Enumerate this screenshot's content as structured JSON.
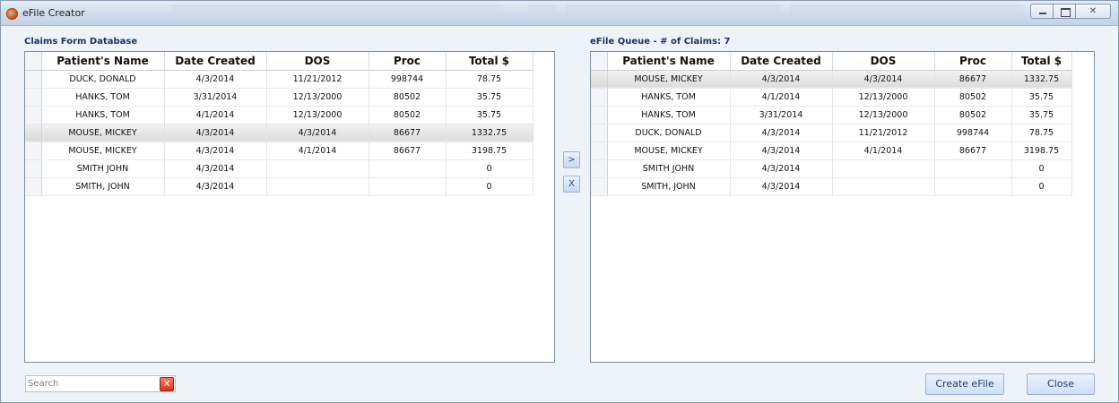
{
  "window": {
    "title": "eFile Creator"
  },
  "left_panel": {
    "title": "Claims Form Database",
    "columns": [
      "Patient's Name",
      "Date Created",
      "DOS",
      "Proc",
      "Total $"
    ],
    "rows": [
      {
        "name": "DUCK, DONALD",
        "date_created": "4/3/2014",
        "dos": "11/21/2012",
        "proc": "998744",
        "total": "78.75",
        "selected": false
      },
      {
        "name": "HANKS, TOM",
        "date_created": "3/31/2014",
        "dos": "12/13/2000",
        "proc": "80502",
        "total": "35.75",
        "selected": false
      },
      {
        "name": "HANKS, TOM",
        "date_created": "4/1/2014",
        "dos": "12/13/2000",
        "proc": "80502",
        "total": "35.75",
        "selected": false
      },
      {
        "name": "MOUSE, MICKEY",
        "date_created": "4/3/2014",
        "dos": "4/3/2014",
        "proc": "86677",
        "total": "1332.75",
        "selected": true
      },
      {
        "name": "MOUSE, MICKEY",
        "date_created": "4/3/2014",
        "dos": "4/1/2014",
        "proc": "86677",
        "total": "3198.75",
        "selected": false
      },
      {
        "name": "SMITH JOHN",
        "date_created": "4/3/2014",
        "dos": "",
        "proc": "",
        "total": "0",
        "selected": false
      },
      {
        "name": "SMITH, JOHN",
        "date_created": "4/3/2014",
        "dos": "",
        "proc": "",
        "total": "0",
        "selected": false
      }
    ]
  },
  "right_panel": {
    "title": "eFile Queue - # of Claims: 7",
    "columns": [
      "Patient's Name",
      "Date Created",
      "DOS",
      "Proc",
      "Total $"
    ],
    "rows": [
      {
        "name": "MOUSE, MICKEY",
        "date_created": "4/3/2014",
        "dos": "4/3/2014",
        "proc": "86677",
        "total": "1332.75",
        "selected": true
      },
      {
        "name": "HANKS, TOM",
        "date_created": "4/1/2014",
        "dos": "12/13/2000",
        "proc": "80502",
        "total": "35.75",
        "selected": false
      },
      {
        "name": "HANKS, TOM",
        "date_created": "3/31/2014",
        "dos": "12/13/2000",
        "proc": "80502",
        "total": "35.75",
        "selected": false
      },
      {
        "name": "DUCK, DONALD",
        "date_created": "4/3/2014",
        "dos": "11/21/2012",
        "proc": "998744",
        "total": "78.75",
        "selected": false
      },
      {
        "name": "MOUSE, MICKEY",
        "date_created": "4/3/2014",
        "dos": "4/1/2014",
        "proc": "86677",
        "total": "3198.75",
        "selected": false
      },
      {
        "name": "SMITH JOHN",
        "date_created": "4/3/2014",
        "dos": "",
        "proc": "",
        "total": "0",
        "selected": false
      },
      {
        "name": "SMITH, JOHN",
        "date_created": "4/3/2014",
        "dos": "",
        "proc": "",
        "total": "0",
        "selected": false
      }
    ]
  },
  "move_buttons": {
    "add_label": ">",
    "remove_label": "X"
  },
  "search": {
    "placeholder": "Search",
    "value": ""
  },
  "buttons": {
    "create_efile": "Create eFile",
    "close": "Close"
  },
  "icons": {
    "app": "efile-app-icon",
    "clear": "clear-x-icon"
  },
  "colors": {
    "selected_row": "#dcdcdc",
    "section_title": "#16345a",
    "window_bg": "#eef3fa"
  }
}
